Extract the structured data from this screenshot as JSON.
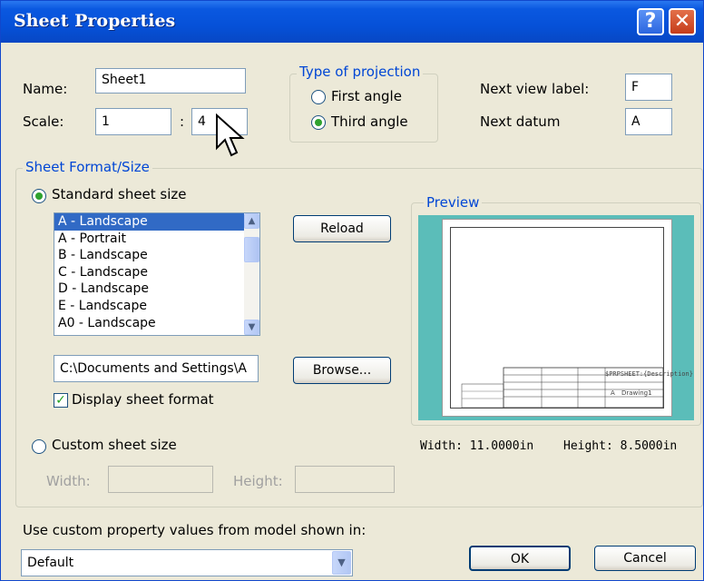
{
  "window": {
    "title": "Sheet Properties",
    "help_glyph": "?",
    "close_glyph": "✕"
  },
  "name": {
    "label": "Name:",
    "value": "Sheet1"
  },
  "scale": {
    "label": "Scale:",
    "value1": "1",
    "separator": ":",
    "value2": "4"
  },
  "projection": {
    "legend": "Type of projection",
    "options": [
      {
        "label": "First angle",
        "selected": false
      },
      {
        "label": "Third angle",
        "selected": true
      }
    ]
  },
  "next_view_label": {
    "label": "Next view label:",
    "value": "F"
  },
  "next_datum": {
    "label": "Next datum",
    "value": "A"
  },
  "sheet_format": {
    "legend": "Sheet Format/Size",
    "standard_label": "Standard sheet size",
    "standard_selected": true,
    "sizes": [
      "A - Landscape",
      "A - Portrait",
      "B - Landscape",
      "C - Landscape",
      "D - Landscape",
      "E - Landscape",
      "A0 - Landscape"
    ],
    "selected_size": "A - Landscape",
    "reload_label": "Reload",
    "path_value": "C:\\Documents and Settings\\A",
    "browse_label": "Browse...",
    "display_format_label": "Display sheet format",
    "display_format_checked": true,
    "custom_label": "Custom sheet size",
    "custom_selected": false,
    "width_label": "Width:",
    "height_label": "Height:",
    "width_value": "",
    "height_value": ""
  },
  "preview": {
    "legend": "Preview",
    "title_block_text": "$PRPSHEET:{Description}",
    "size_text": "A",
    "dwg_text": "Drawing1",
    "width_text": "Width:  11.0000in",
    "height_text": "Height:  8.5000in"
  },
  "custom_property": {
    "label": "Use custom property values from model shown in:",
    "value": "Default"
  },
  "ok_label": "OK",
  "cancel_label": "Cancel",
  "colors": {
    "title_bar": "#0651d8",
    "group_legend": "#0046d5",
    "selection": "#316ac5",
    "preview_background": "#5bbdb9"
  }
}
